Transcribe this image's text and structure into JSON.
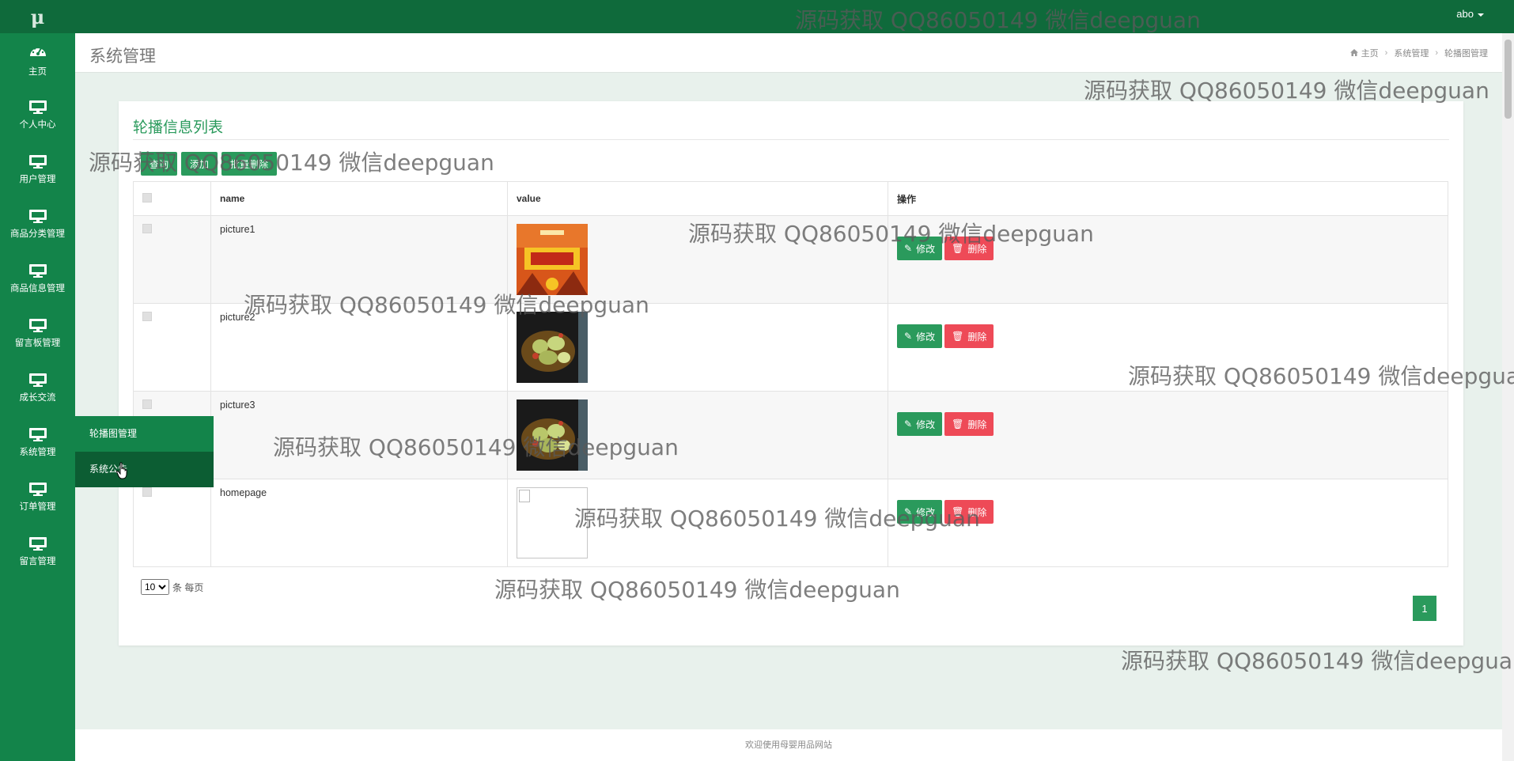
{
  "app": {
    "logo": "μ",
    "user": "abo"
  },
  "sidebar": {
    "items": [
      {
        "label": "主页",
        "icon": "dashboard-icon"
      },
      {
        "label": "个人中心",
        "icon": "monitor-icon"
      },
      {
        "label": "用户管理",
        "icon": "monitor-icon"
      },
      {
        "label": "商品分类管理",
        "icon": "monitor-icon"
      },
      {
        "label": "商品信息管理",
        "icon": "monitor-icon"
      },
      {
        "label": "留言板管理",
        "icon": "monitor-icon"
      },
      {
        "label": "成长交流",
        "icon": "monitor-icon"
      },
      {
        "label": "系统管理",
        "icon": "monitor-icon"
      },
      {
        "label": "订单管理",
        "icon": "monitor-icon"
      },
      {
        "label": "留言管理",
        "icon": "monitor-icon"
      }
    ],
    "submenu": [
      {
        "label": "轮播图管理"
      },
      {
        "label": "系统公告"
      }
    ]
  },
  "header": {
    "title": "系统管理",
    "breadcrumb": [
      "主页",
      "系统管理",
      "轮播图管理"
    ]
  },
  "card": {
    "title": "轮播信息列表",
    "toolbar": {
      "query": "查询",
      "add": "添加",
      "batch_delete": "批量删除"
    },
    "columns": [
      "",
      "name",
      "value",
      "操作"
    ],
    "rows": [
      {
        "name": "picture1",
        "image": "promo-poster"
      },
      {
        "name": "picture2",
        "image": "food-photo"
      },
      {
        "name": "picture3",
        "image": "food-photo"
      },
      {
        "name": "homepage",
        "image": "broken-image"
      }
    ],
    "edit_label": "修改",
    "delete_label": "删除",
    "page_size": {
      "value": "10",
      "suffix": "条 每页"
    },
    "current_page": "1"
  },
  "footer": {
    "text": "欢迎使用母婴用品网站"
  },
  "watermark": "源码获取 QQ86050149 微信deepguan",
  "colors": {
    "primary": "#2a9a5c",
    "sidebar": "#13844a",
    "topbar": "#0f6a3b",
    "danger": "#ee4a57"
  }
}
